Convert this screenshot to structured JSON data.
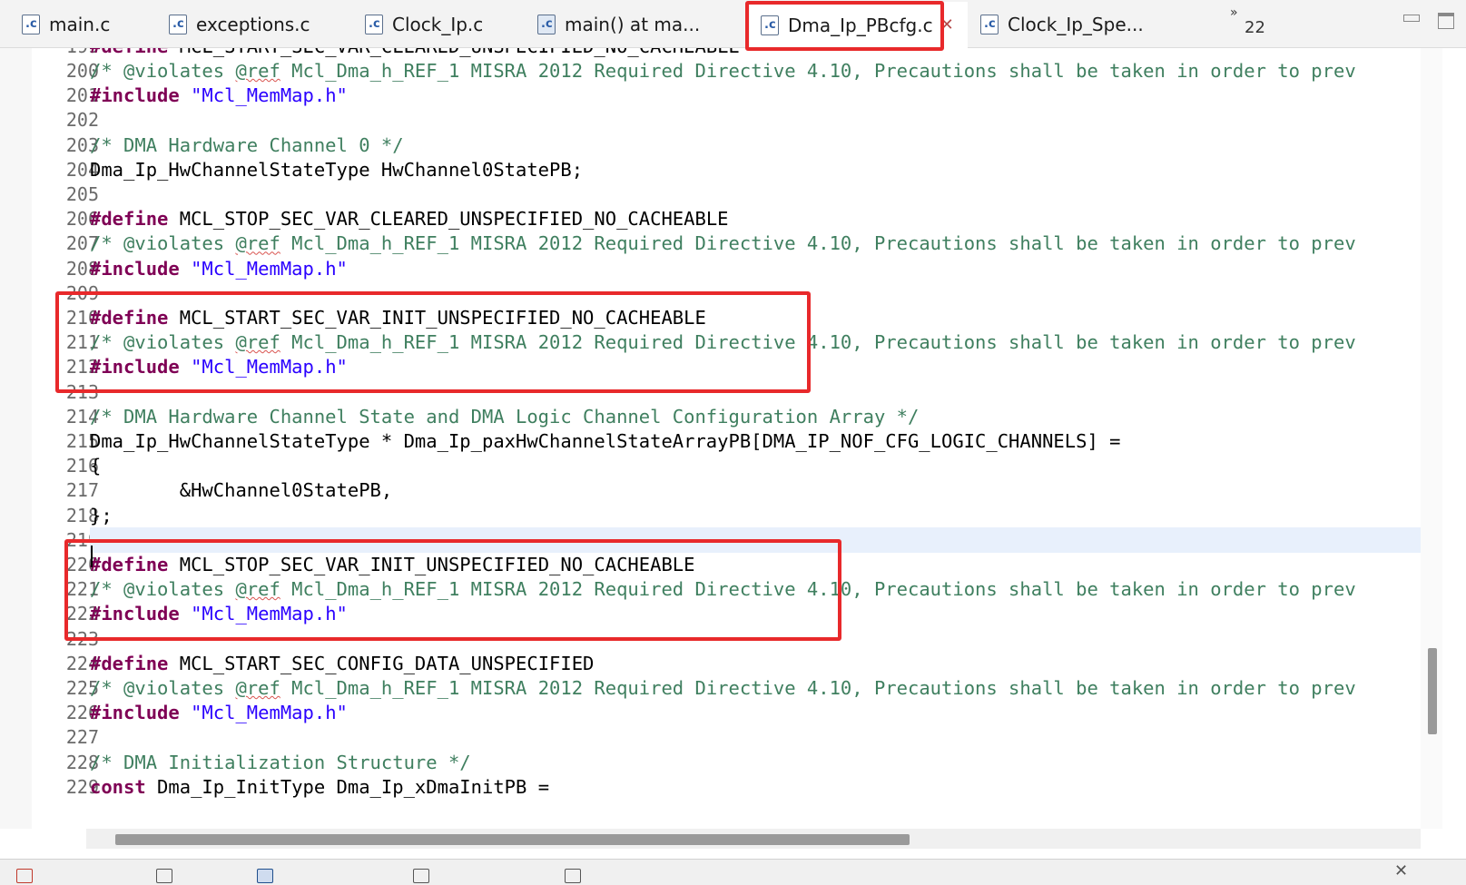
{
  "tabs": [
    {
      "label": "main.c",
      "icon": "c-file-icon",
      "active": false
    },
    {
      "label": "exceptions.c",
      "icon": "c-file-icon",
      "active": false
    },
    {
      "label": "Clock_Ip.c",
      "icon": "c-file-icon",
      "active": false
    },
    {
      "label": "main() at ma...",
      "icon": "c-file-icon",
      "active": false
    },
    {
      "label": "Dma_Ip_PBcfg.c",
      "icon": "c-file-icon",
      "active": true
    },
    {
      "label": "Clock_Ip_Spe...",
      "icon": "c-file-icon",
      "active": false
    }
  ],
  "tab_overflow": {
    "chevron": "»",
    "count": "22"
  },
  "highlight_color": "#e8292b",
  "code": {
    "partial_top_line": {
      "num": "199",
      "text": "#define MCL_START_SEC_VAR_CLEARED_UNSPECIFIED_NO_CACHEABLE"
    },
    "lines": [
      {
        "num": "200",
        "text": "/* @violates @ref Mcl_Dma_h_REF_1 MISRA 2012 Required Directive 4.10, Precautions shall be taken in order to prev"
      },
      {
        "num": "201",
        "text": "#include \"Mcl_MemMap.h\""
      },
      {
        "num": "202",
        "text": ""
      },
      {
        "num": "203",
        "text": "/* DMA Hardware Channel 0 */"
      },
      {
        "num": "204",
        "text": "Dma_Ip_HwChannelStateType HwChannel0StatePB;"
      },
      {
        "num": "205",
        "text": ""
      },
      {
        "num": "206",
        "text": "#define MCL_STOP_SEC_VAR_CLEARED_UNSPECIFIED_NO_CACHEABLE"
      },
      {
        "num": "207",
        "text": "/* @violates @ref Mcl_Dma_h_REF_1 MISRA 2012 Required Directive 4.10, Precautions shall be taken in order to prev"
      },
      {
        "num": "208",
        "text": "#include \"Mcl_MemMap.h\""
      },
      {
        "num": "209",
        "text": ""
      },
      {
        "num": "210",
        "text": "#define MCL_START_SEC_VAR_INIT_UNSPECIFIED_NO_CACHEABLE"
      },
      {
        "num": "211",
        "text": "/* @violates @ref Mcl_Dma_h_REF_1 MISRA 2012 Required Directive 4.10, Precautions shall be taken in order to prev"
      },
      {
        "num": "212",
        "text": "#include \"Mcl_MemMap.h\""
      },
      {
        "num": "213",
        "text": ""
      },
      {
        "num": "214",
        "text": "/* DMA Hardware Channel State and DMA Logic Channel Configuration Array */"
      },
      {
        "num": "215",
        "text": "Dma_Ip_HwChannelStateType * Dma_Ip_paxHwChannelStateArrayPB[DMA_IP_NOF_CFG_LOGIC_CHANNELS] ="
      },
      {
        "num": "216",
        "text": "{"
      },
      {
        "num": "217",
        "text": "        &HwChannel0StatePB,"
      },
      {
        "num": "218",
        "text": "};"
      },
      {
        "num": "219",
        "text": ""
      },
      {
        "num": "220",
        "text": "#define MCL_STOP_SEC_VAR_INIT_UNSPECIFIED_NO_CACHEABLE"
      },
      {
        "num": "221",
        "text": "/* @violates @ref Mcl_Dma_h_REF_1 MISRA 2012 Required Directive 4.10, Precautions shall be taken in order to prev"
      },
      {
        "num": "222",
        "text": "#include \"Mcl_MemMap.h\""
      },
      {
        "num": "223",
        "text": ""
      },
      {
        "num": "224",
        "text": "#define MCL_START_SEC_CONFIG_DATA_UNSPECIFIED"
      },
      {
        "num": "225",
        "text": "/* @violates @ref Mcl_Dma_h_REF_1 MISRA 2012 Required Directive 4.10, Precautions shall be taken in order to prev"
      },
      {
        "num": "226",
        "text": "#include \"Mcl_MemMap.h\""
      },
      {
        "num": "227",
        "text": ""
      },
      {
        "num": "228",
        "text": "/* DMA Initialization Structure */"
      },
      {
        "num": "229",
        "text": "const Dma_Ip_InitType Dma_Ip_xDmaInitPB ="
      }
    ],
    "current_line": "219"
  }
}
